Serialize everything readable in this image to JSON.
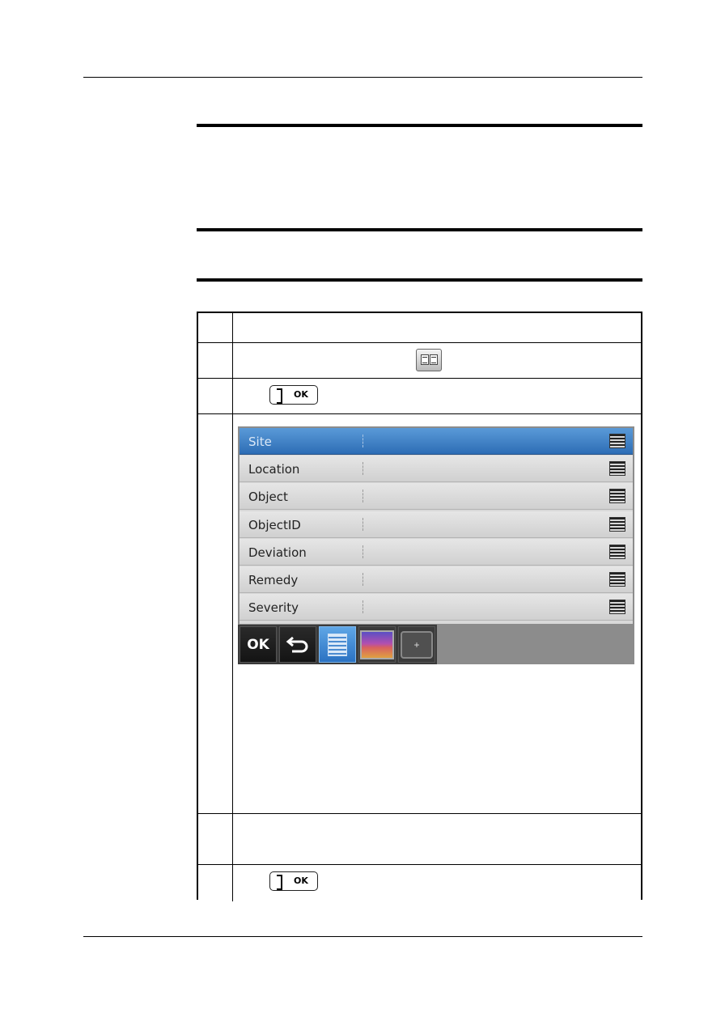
{
  "ok_key": {
    "label": "OK"
  },
  "device": {
    "fields": [
      {
        "label": "Site",
        "selected": true
      },
      {
        "label": "Location",
        "selected": false
      },
      {
        "label": "Object",
        "selected": false
      },
      {
        "label": "ObjectID",
        "selected": false
      },
      {
        "label": "Deviation",
        "selected": false
      },
      {
        "label": "Remedy",
        "selected": false
      },
      {
        "label": "Severity",
        "selected": false
      }
    ],
    "toolbar": {
      "ok_label": "OK",
      "back_icon": "back-arrow-icon",
      "list_icon": "text-annotation-icon",
      "image_icon": "thermal-image-icon",
      "add_icon": "add-annotation-icon"
    }
  },
  "colors": {
    "selected_row": "#2d6db5",
    "row_background": "#d9d9d9",
    "toolbar": "#3a3a3a"
  }
}
